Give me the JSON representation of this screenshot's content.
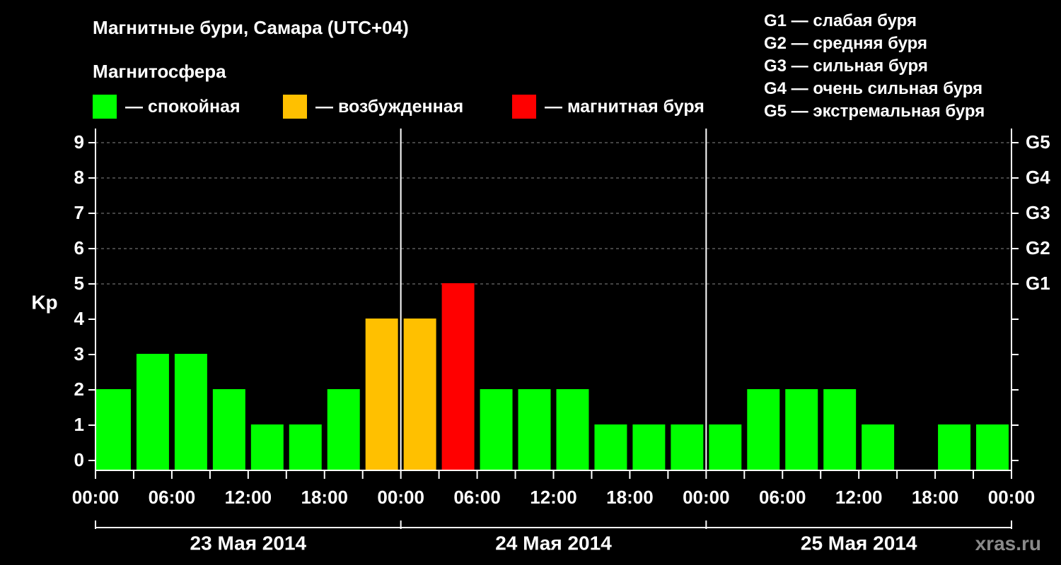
{
  "title": "Магнитные бури, Самара (UTC+04)",
  "subtitle": "Магнитосфера",
  "legend": [
    {
      "label": "— спокойная",
      "color": "#00ff00"
    },
    {
      "label": "— возбужденная",
      "color": "#ffc000"
    },
    {
      "label": "— магнитная буря",
      "color": "#ff0000"
    }
  ],
  "g_scale": [
    "G1 — слабая буря",
    "G2 — средняя буря",
    "G3 — сильная буря",
    "G4 — очень сильная буря",
    "G5 — экстремальная буря"
  ],
  "watermark": "xras.ru",
  "chart_data": {
    "type": "bar",
    "ylabel": "Kp",
    "ylim": [
      0,
      9
    ],
    "y_ticks": [
      "0",
      "1",
      "2",
      "3",
      "4",
      "5",
      "6",
      "7",
      "8",
      "9"
    ],
    "right_axis_labels": [
      {
        "value": 5,
        "label": "G1"
      },
      {
        "value": 6,
        "label": "G2"
      },
      {
        "value": 7,
        "label": "G3"
      },
      {
        "value": 8,
        "label": "G4"
      },
      {
        "value": 9,
        "label": "G5"
      }
    ],
    "x_tick_labels": [
      "00:00",
      "06:00",
      "12:00",
      "18:00",
      "00:00",
      "06:00",
      "12:00",
      "18:00",
      "00:00",
      "06:00",
      "12:00",
      "18:00",
      "00:00"
    ],
    "days": [
      "23 Мая 2014",
      "24 Мая 2014",
      "25 Мая 2014"
    ],
    "interval_hours": 3,
    "interval_starts": [
      "23 Мая 2014 00:00",
      "03:00",
      "06:00",
      "09:00",
      "12:00",
      "15:00",
      "18:00",
      "21:00",
      "24 Мая 2014 00:00",
      "03:00",
      "06:00",
      "09:00",
      "12:00",
      "15:00",
      "18:00",
      "21:00",
      "25 Мая 2014 00:00",
      "03:00",
      "06:00",
      "09:00",
      "12:00",
      "15:00",
      "18:00",
      "21:00"
    ],
    "values": [
      2,
      3,
      3,
      2,
      1,
      1,
      2,
      4,
      4,
      5,
      2,
      2,
      2,
      1,
      1,
      1,
      1,
      2,
      2,
      2,
      1,
      null,
      1,
      1
    ],
    "colors": {
      "quiet": "#00ff00",
      "active": "#ffc000",
      "storm": "#ff0000"
    },
    "grid_y": [
      5,
      6,
      7,
      8,
      9
    ]
  }
}
